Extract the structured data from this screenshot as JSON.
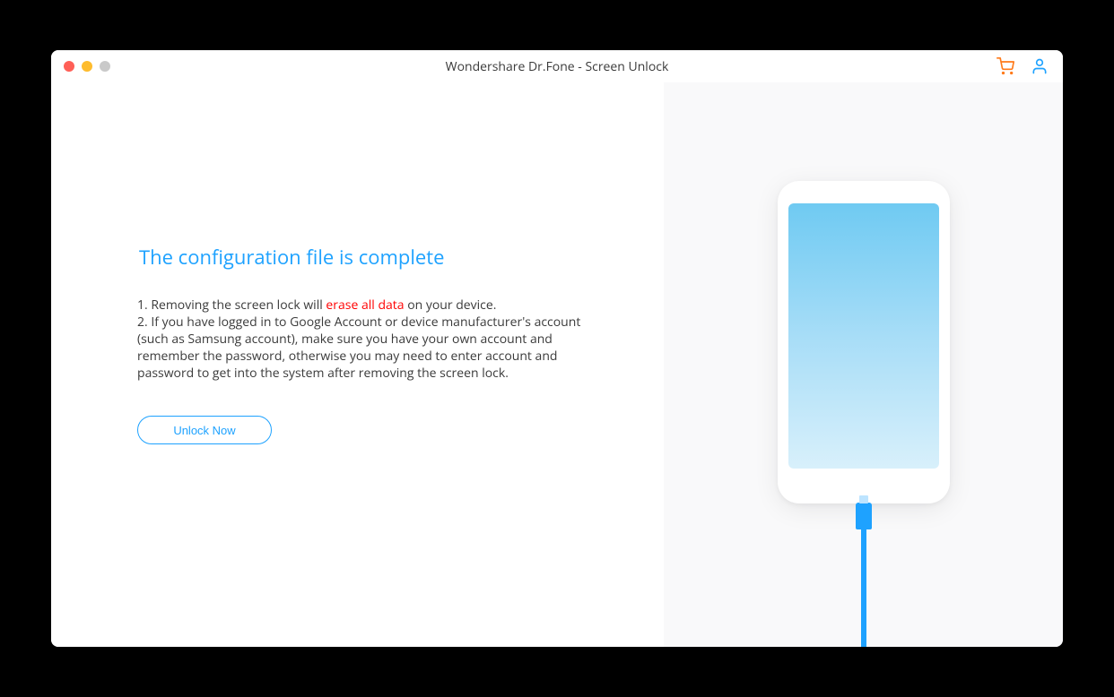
{
  "window": {
    "title": "Wondershare Dr.Fone - Screen Unlock"
  },
  "main": {
    "heading": "The configuration file is complete",
    "item1_prefix": "1. Removing the screen lock will ",
    "item1_highlight": "erase all data",
    "item1_suffix": " on your device.",
    "item2": "2. If you have logged in to Google Account or device manufacturer's account (such as Samsung account), make sure you have your own account and remember the password, otherwise you may need to enter account and password to get into the system after removing the screen lock.",
    "button": "Unlock Now"
  }
}
